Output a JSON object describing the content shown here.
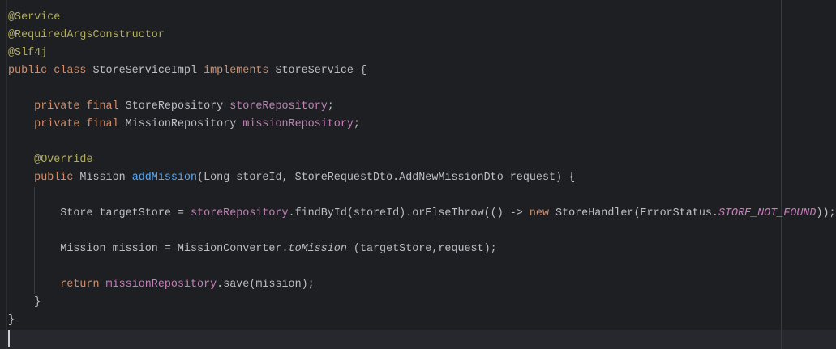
{
  "editor": {
    "colors": {
      "background": "#1e1f22",
      "annotation": "#b3ae60",
      "keyword": "#cf8e6d",
      "plain": "#bcbec4",
      "field": "#c77dbb",
      "method": "#56a8f5"
    },
    "lines": [
      [
        {
          "t": "annotation",
          "s": "@Service"
        }
      ],
      [
        {
          "t": "annotation",
          "s": "@RequiredArgsConstructor"
        }
      ],
      [
        {
          "t": "annotation",
          "s": "@Slf4j"
        }
      ],
      [
        {
          "t": "keyword",
          "s": "public class "
        },
        {
          "t": "plain",
          "s": "StoreServiceImpl "
        },
        {
          "t": "keyword",
          "s": "implements "
        },
        {
          "t": "plain",
          "s": "StoreService {"
        }
      ],
      [],
      [
        {
          "t": "plain",
          "s": "    "
        },
        {
          "t": "keyword",
          "s": "private final "
        },
        {
          "t": "plain",
          "s": "StoreRepository "
        },
        {
          "t": "field",
          "s": "storeRepository"
        },
        {
          "t": "plain",
          "s": ";"
        }
      ],
      [
        {
          "t": "plain",
          "s": "    "
        },
        {
          "t": "keyword",
          "s": "private final "
        },
        {
          "t": "plain",
          "s": "MissionRepository "
        },
        {
          "t": "field",
          "s": "missionRepository"
        },
        {
          "t": "plain",
          "s": ";"
        }
      ],
      [],
      [
        {
          "t": "plain",
          "s": "    "
        },
        {
          "t": "annotation",
          "s": "@Override"
        }
      ],
      [
        {
          "t": "plain",
          "s": "    "
        },
        {
          "t": "keyword",
          "s": "public "
        },
        {
          "t": "plain",
          "s": "Mission "
        },
        {
          "t": "method",
          "s": "addMission"
        },
        {
          "t": "plain",
          "s": "(Long storeId, StoreRequestDto.AddNewMissionDto request) {"
        }
      ],
      [],
      [
        {
          "t": "plain",
          "s": "        Store targetStore = "
        },
        {
          "t": "field",
          "s": "storeRepository"
        },
        {
          "t": "plain",
          "s": ".findById(storeId).orElseThrow(() -> "
        },
        {
          "t": "keyword",
          "s": "new "
        },
        {
          "t": "plain",
          "s": "StoreHandler(ErrorStatus."
        },
        {
          "t": "constant",
          "s": "STORE_NOT_FOUND"
        },
        {
          "t": "plain",
          "s": "));"
        }
      ],
      [],
      [
        {
          "t": "plain",
          "s": "        Mission mission = MissionConverter."
        },
        {
          "t": "static",
          "s": "toMission"
        },
        {
          "t": "plain",
          "s": " (targetStore,request);"
        }
      ],
      [],
      [
        {
          "t": "plain",
          "s": "        "
        },
        {
          "t": "keyword",
          "s": "return "
        },
        {
          "t": "field",
          "s": "missionRepository"
        },
        {
          "t": "plain",
          "s": ".save(mission);"
        }
      ],
      [
        {
          "t": "plain",
          "s": "    }"
        }
      ],
      [
        {
          "t": "plain",
          "s": "}"
        }
      ],
      []
    ]
  }
}
